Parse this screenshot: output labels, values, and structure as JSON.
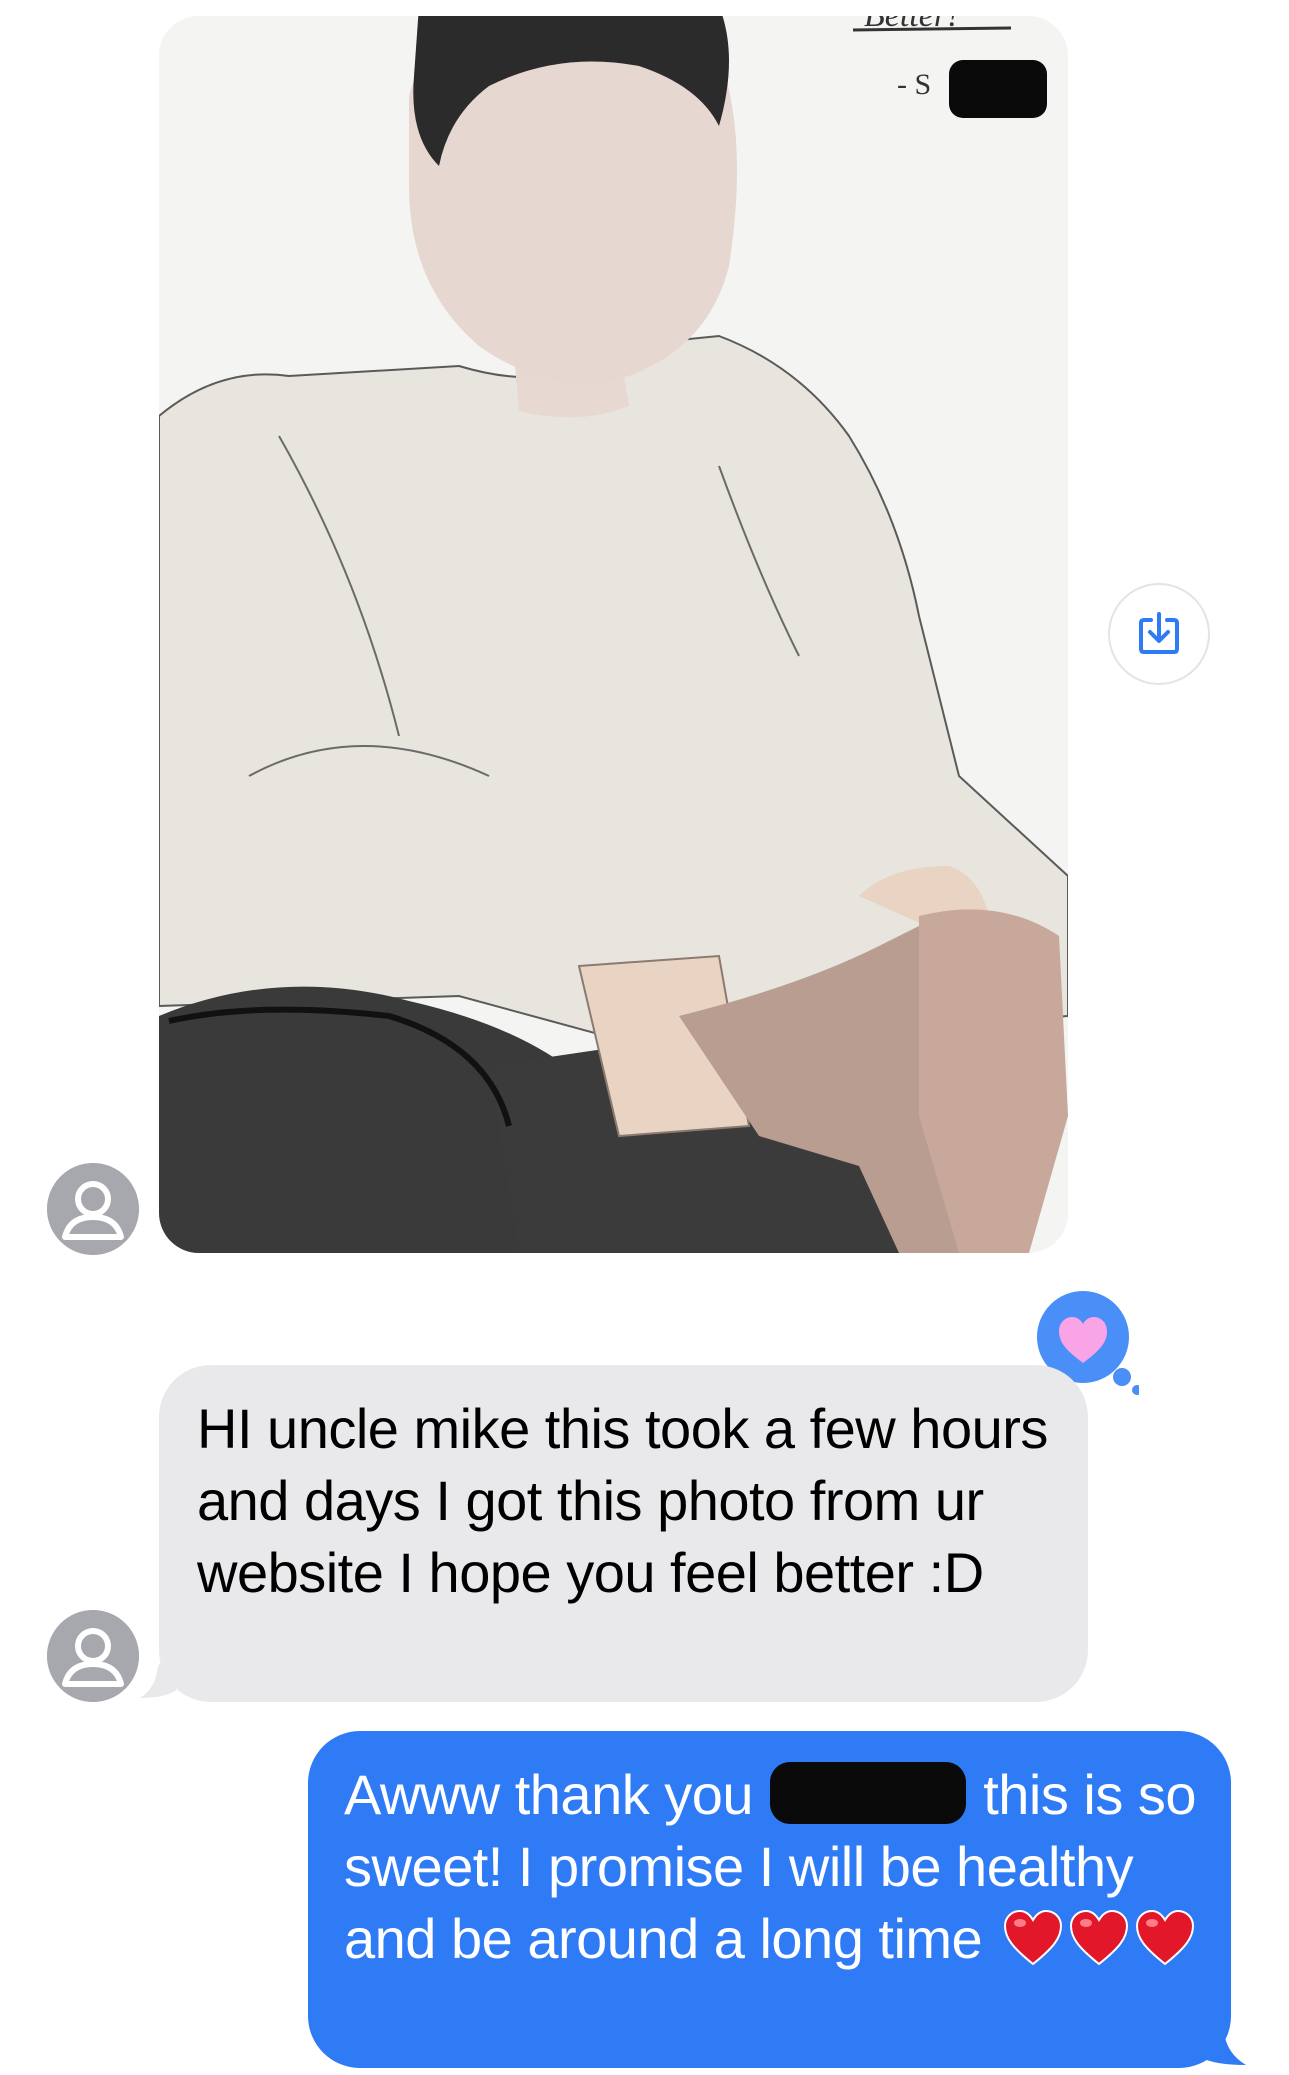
{
  "conversation": {
    "incoming_image": {
      "caption_text": "Better!",
      "signature_text": "- S"
    },
    "save_icon": "square-arrow-down-icon",
    "tapback_icon": "pink-heart-icon",
    "incoming_message": {
      "text": "HI  uncle mike this took a few hours and days I got this photo from ur website I hope you feel better :D"
    },
    "outgoing_message": {
      "text_before": "Awww thank you",
      "text_after": "this is so sweet! I promise I will be healthy and be around a long time",
      "emoji_icons": [
        "red-heart-icon",
        "red-heart-icon",
        "red-heart-icon"
      ]
    },
    "colors": {
      "incoming_bubble": "#e9e9eb",
      "outgoing_bubble": "#2f7bf6",
      "tapback_bubble": "#4a8ef8",
      "avatar": "#a7a8ad"
    }
  }
}
